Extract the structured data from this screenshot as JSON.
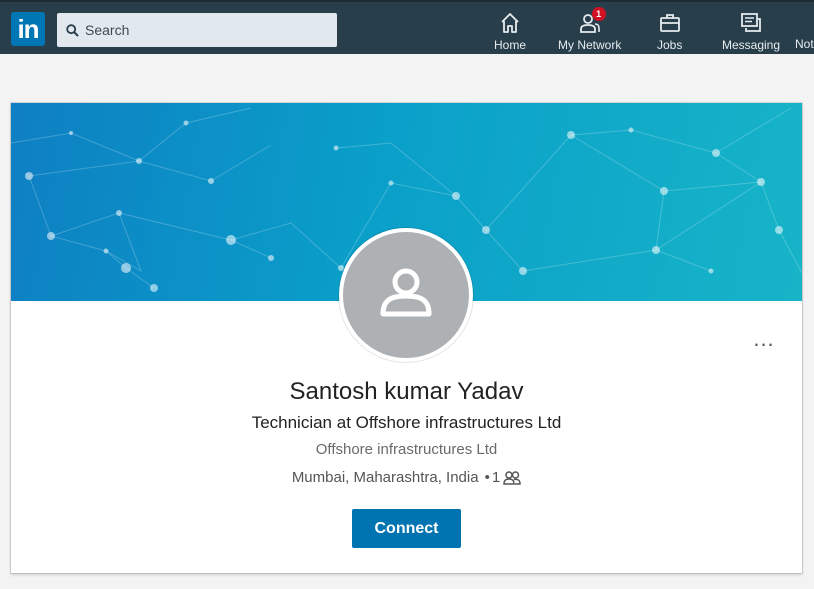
{
  "nav": {
    "logo_text": "in",
    "search_placeholder": "Search",
    "items": [
      {
        "label": "Home",
        "icon": "home-icon"
      },
      {
        "label": "My Network",
        "icon": "people-icon",
        "badge": "1"
      },
      {
        "label": "Jobs",
        "icon": "briefcase-icon"
      },
      {
        "label": "Messaging",
        "icon": "messaging-icon"
      },
      {
        "label": "Not",
        "icon": "bell-icon"
      }
    ]
  },
  "profile": {
    "name": "Santosh kumar Yadav",
    "headline": "Technician at Offshore infrastructures Ltd",
    "company": "Offshore infrastructures Ltd",
    "location": "Mumbai, Maharashtra, India",
    "connection_separator": "•",
    "connection_degree": "1",
    "connect_label": "Connect",
    "more_label": "..."
  },
  "colors": {
    "nav_bg": "#283e4a",
    "brand": "#0077b5",
    "connect_bg": "#0073b1",
    "badge": "#d11124"
  }
}
